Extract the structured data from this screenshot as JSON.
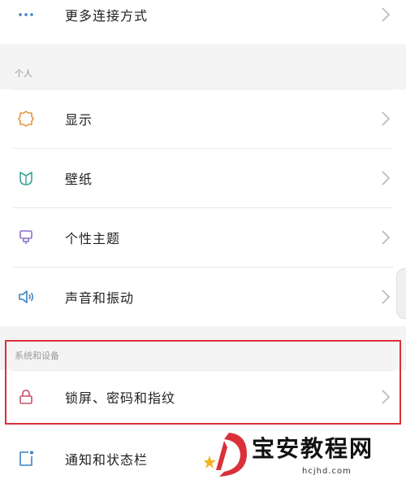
{
  "rows": {
    "more": "更多连接方式",
    "display": "显示",
    "wallpaper": "壁纸",
    "theme": "个性主题",
    "sound": "声音和振动",
    "lock": "锁屏、密码和指纹",
    "notify": "通知和状态栏"
  },
  "sections": {
    "personal": "个人",
    "system": "系统和设备"
  },
  "icons": {
    "more": "more-dots-icon",
    "display": "brightness-icon",
    "wallpaper": "wallpaper-icon",
    "theme": "theme-brush-icon",
    "sound": "speaker-icon",
    "lock": "lock-icon",
    "notify": "notification-icon"
  },
  "highlight_color": "#d9303a",
  "watermark": {
    "text": "宝安教程网",
    "url": "hcjhd.com"
  }
}
